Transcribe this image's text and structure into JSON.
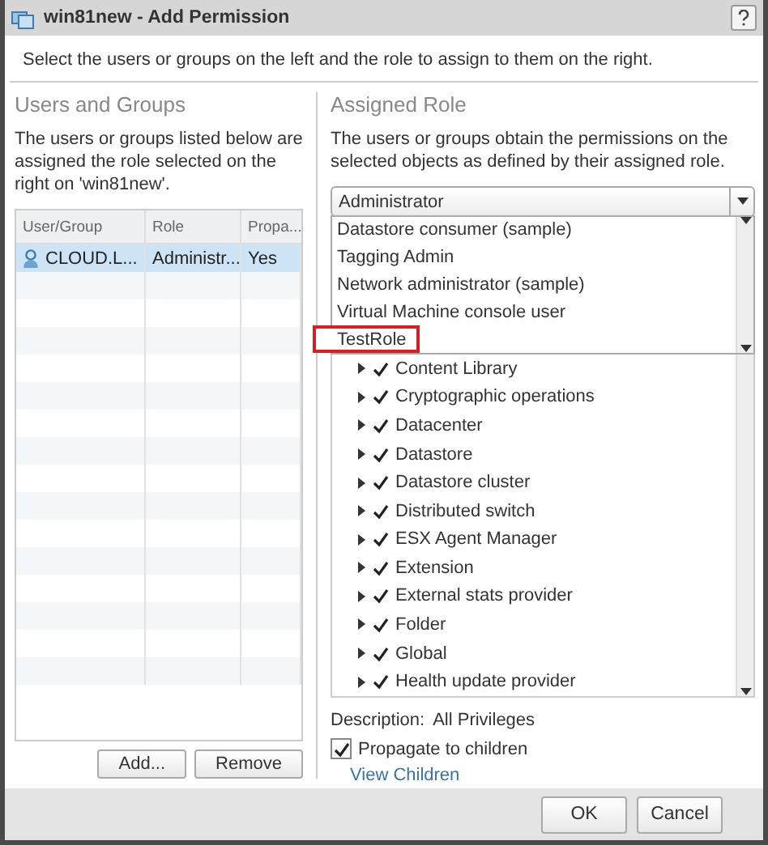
{
  "window": {
    "title": "win81new - Add Permission"
  },
  "instruction": "Select the users or groups on the left and the role to assign to them on the right.",
  "users_panel": {
    "heading": "Users and Groups",
    "description": "The users or groups listed below are assigned the role selected on the right on 'win81new'.",
    "columns": [
      "User/Group",
      "Role",
      "Propa..."
    ],
    "rows": [
      {
        "cells": [
          "CLOUD.L...",
          "Administr...",
          "Yes"
        ],
        "selected": true
      }
    ],
    "buttons": [
      "Add...",
      "Remove"
    ]
  },
  "role_panel": {
    "heading": "Assigned Role",
    "description": "The users or groups obtain the permissions on the selected objects as defined by their assigned role.",
    "role_select": {
      "value": "Administrator"
    },
    "role_options": [
      {
        "label": "Datastore consumer (sample)",
        "highlighted": false
      },
      {
        "label": "Tagging Admin",
        "highlighted": false
      },
      {
        "label": "Network administrator (sample)",
        "highlighted": false
      },
      {
        "label": "Virtual Machine console user",
        "highlighted": false
      },
      {
        "label": "TestRole",
        "highlighted": true
      }
    ],
    "privileges": [
      {
        "label": "Content Library",
        "checked": true,
        "expanded": false
      },
      {
        "label": "Cryptographic operations",
        "checked": true,
        "expanded": false
      },
      {
        "label": "Datacenter",
        "checked": true,
        "expanded": false
      },
      {
        "label": "Datastore",
        "checked": true,
        "expanded": false
      },
      {
        "label": "Datastore cluster",
        "checked": true,
        "expanded": false
      },
      {
        "label": "Distributed switch",
        "checked": true,
        "expanded": false
      },
      {
        "label": "ESX Agent Manager",
        "checked": true,
        "expanded": false
      },
      {
        "label": "Extension",
        "checked": true,
        "expanded": false
      },
      {
        "label": "External stats provider",
        "checked": true,
        "expanded": false
      },
      {
        "label": "Folder",
        "checked": true,
        "expanded": false
      },
      {
        "label": "Global",
        "checked": true,
        "expanded": false
      },
      {
        "label": "Health update provider",
        "checked": true,
        "expanded": false
      }
    ],
    "description_label": "Description:",
    "description_value": "All Privileges",
    "propagate": {
      "label": "Propagate to children",
      "checked": true
    },
    "view_children": "View Children"
  },
  "footer_buttons": [
    "OK",
    "Cancel"
  ]
}
